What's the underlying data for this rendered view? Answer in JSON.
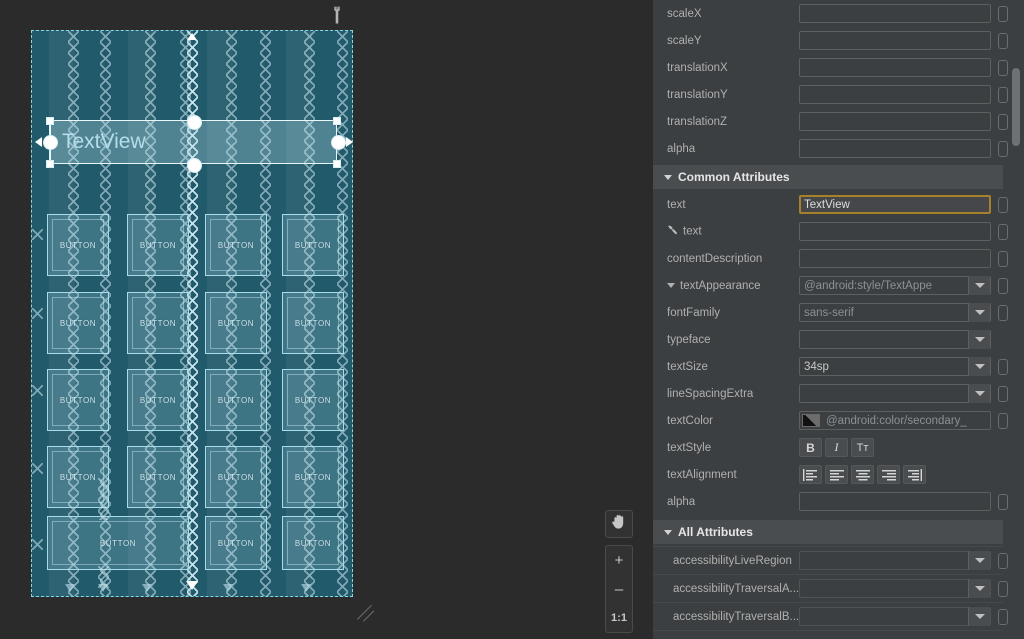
{
  "canvas": {
    "wrench_icon": "wrench-icon",
    "zoom_controls": {
      "pan_icon": "hand-pan-icon",
      "zoom_in_label": "+",
      "zoom_out_label": "–",
      "zoom_reset_label": "1:1"
    },
    "selected_widget": {
      "label": "TextView",
      "type": "TextView"
    },
    "widgets": [
      {
        "label": "BUTTON",
        "row": 1,
        "col": 1
      },
      {
        "label": "BUTTON",
        "row": 1,
        "col": 2
      },
      {
        "label": "BUTTON",
        "row": 1,
        "col": 3
      },
      {
        "label": "BUTTON",
        "row": 1,
        "col": 4
      },
      {
        "label": "BUTTON",
        "row": 2,
        "col": 1
      },
      {
        "label": "BUTTON",
        "row": 2,
        "col": 2
      },
      {
        "label": "BUTTON",
        "row": 2,
        "col": 3
      },
      {
        "label": "BUTTON",
        "row": 2,
        "col": 4
      },
      {
        "label": "BUTTON",
        "row": 3,
        "col": 1
      },
      {
        "label": "BUTTON",
        "row": 3,
        "col": 2
      },
      {
        "label": "BUTTON",
        "row": 3,
        "col": 3
      },
      {
        "label": "BUTTON",
        "row": 3,
        "col": 4
      },
      {
        "label": "BUTTON",
        "row": 4,
        "col": 1
      },
      {
        "label": "BUTTON",
        "row": 4,
        "col": 2
      },
      {
        "label": "BUTTON",
        "row": 4,
        "col": 3
      },
      {
        "label": "BUTTON",
        "row": 4,
        "col": 4
      },
      {
        "label": "BUTTON",
        "row": 5,
        "col": 1
      },
      {
        "label": "BUTTON",
        "row": 5,
        "col": 3
      },
      {
        "label": "BUTTON",
        "row": 5,
        "col": 4
      }
    ],
    "colors": {
      "blueprint_background": "#215a6b",
      "blueprint_outline": "#8fd4e4",
      "widget_outline": "#a9dcea",
      "selection_handle": "#ffffff",
      "editor_background": "#2b2b2b"
    }
  },
  "attributes_panel": {
    "transform_rows": [
      {
        "name": "scaleX",
        "value": "",
        "control": "text"
      },
      {
        "name": "scaleY",
        "value": "",
        "control": "text"
      },
      {
        "name": "translationX",
        "value": "",
        "control": "text"
      },
      {
        "name": "translationY",
        "value": "",
        "control": "text"
      },
      {
        "name": "translationZ",
        "value": "",
        "control": "text"
      },
      {
        "name": "alpha",
        "value": "",
        "control": "text"
      }
    ],
    "common_attributes": {
      "header": "Common Attributes",
      "rows": [
        {
          "name": "text",
          "value": "TextView",
          "control": "text",
          "focused": true
        },
        {
          "name": "text",
          "value": "",
          "control": "text",
          "icon": "wrench-icon"
        },
        {
          "name": "contentDescription",
          "value": "",
          "control": "text"
        },
        {
          "name": "textAppearance",
          "value": "@android:style/TextAppe",
          "control": "dropdown",
          "expandable": true
        },
        {
          "name": "fontFamily",
          "value": "sans-serif",
          "control": "dropdown"
        },
        {
          "name": "typeface",
          "value": "",
          "control": "dropdown"
        },
        {
          "name": "textSize",
          "value": "34sp",
          "control": "dropdown"
        },
        {
          "name": "lineSpacingExtra",
          "value": "",
          "control": "dropdown"
        },
        {
          "name": "textColor",
          "value": "@android:color/secondary_",
          "control": "color"
        },
        {
          "name": "textStyle",
          "value": "",
          "control": "style-toggle"
        },
        {
          "name": "textAlignment",
          "value": "",
          "control": "alignment-toggle"
        },
        {
          "name": "alpha",
          "value": "",
          "control": "text"
        }
      ],
      "text_style_buttons": [
        {
          "name": "bold",
          "glyph": "B"
        },
        {
          "name": "italic",
          "glyph": "I"
        },
        {
          "name": "all-caps",
          "glyph": "Tт"
        }
      ],
      "text_alignment_buttons": [
        {
          "name": "align-text-start"
        },
        {
          "name": "align-left"
        },
        {
          "name": "align-center"
        },
        {
          "name": "align-right"
        },
        {
          "name": "align-text-end"
        }
      ]
    },
    "all_attributes": {
      "header": "All Attributes",
      "rows": [
        {
          "name": "accessibilityLiveRegion",
          "value": "",
          "control": "dropdown"
        },
        {
          "name": "accessibilityTraversalA...",
          "value": "",
          "control": "dropdown"
        },
        {
          "name": "accessibilityTraversalB...",
          "value": "",
          "control": "dropdown"
        }
      ]
    },
    "colors": {
      "panel_background": "#3c3f41",
      "section_header_background": "#4a4d4f",
      "focus_border": "#a6802a",
      "label_text": "#b0b0b0"
    }
  }
}
